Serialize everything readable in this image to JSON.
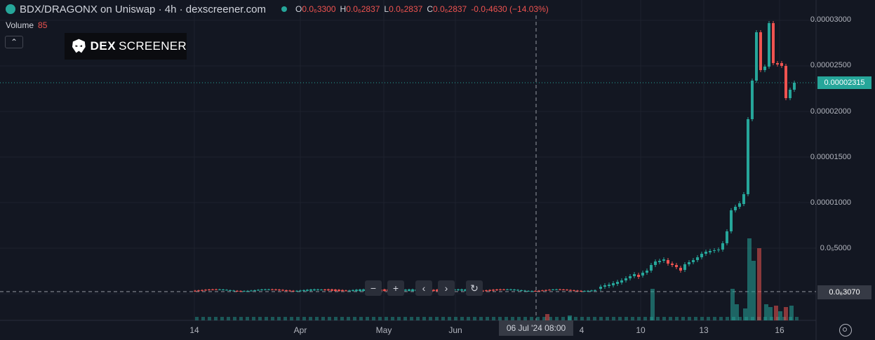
{
  "header": {
    "title": "BDX/DRAGONX on Uniswap · 4h · dexscreener.com",
    "ohlc": [
      {
        "key": "O",
        "value": "0.0₆3300"
      },
      {
        "key": "H",
        "value": "0.0₆2837"
      },
      {
        "key": "L",
        "value": "0.0₆2837"
      },
      {
        "key": "C",
        "value": "0.0₆2837"
      }
    ],
    "change": "-0.0₇4630 (−14.03%)"
  },
  "volume": {
    "label": "Volume",
    "value": "85"
  },
  "watermark": {
    "bold": "DEX",
    "rest": "SCREENER"
  },
  "price_axis": [
    "0.00003000",
    "0.00002500",
    "0.00002000",
    "0.00001500",
    "0.00001000",
    "0.0₅5000"
  ],
  "current_price": "0.00002315",
  "low_price": "0.0₆3070",
  "time_axis": [
    "14",
    "Apr",
    "May",
    "Jun",
    "4",
    "10",
    "13",
    "16"
  ],
  "crosshair_label": "06 Jul '24   08:00",
  "controls": {
    "zoom_out": "−",
    "zoom_in": "+",
    "scroll_left": "‹",
    "scroll_right": "›",
    "reset": "↻"
  },
  "colors": {
    "up": "#26a69a",
    "down": "#ef5350",
    "bg": "#131722"
  },
  "icons": [
    "collapse-chevron-icon",
    "dexscreener-logo-icon",
    "settings-gear-icon"
  ]
}
